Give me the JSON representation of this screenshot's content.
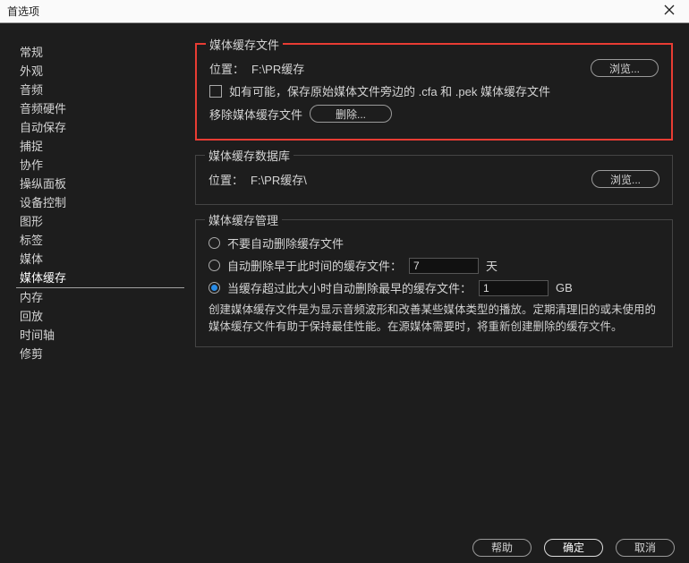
{
  "titlebar": {
    "title": "首选项"
  },
  "sidebar": {
    "items": [
      "常规",
      "外观",
      "音频",
      "音频硬件",
      "自动保存",
      "捕捉",
      "协作",
      "操纵面板",
      "设备控制",
      "图形",
      "标签",
      "媒体",
      "媒体缓存",
      "内存",
      "回放",
      "时间轴",
      "修剪"
    ],
    "selected_index": 12
  },
  "cache_files": {
    "title": "媒体缓存文件",
    "location_label": "位置：",
    "location_value": "F:\\PR缓存",
    "browse": "浏览...",
    "checkbox_label": "如有可能，保存原始媒体文件旁边的 .cfa 和 .pek 媒体缓存文件",
    "remove_label": "移除媒体缓存文件",
    "delete": "删除..."
  },
  "cache_db": {
    "title": "媒体缓存数据库",
    "location_label": "位置：",
    "location_value": "F:\\PR缓存\\",
    "browse": "浏览..."
  },
  "cache_mgmt": {
    "title": "媒体缓存管理",
    "option1": "不要自动删除缓存文件",
    "option2_pre": "自动删除早于此时间的缓存文件：",
    "option2_value": "7",
    "option2_unit": "天",
    "option3_pre": "当缓存超过此大小时自动删除最早的缓存文件：",
    "option3_value": "1",
    "option3_unit": "GB",
    "selected": 3,
    "description": "创建媒体缓存文件是为显示音频波形和改善某些媒体类型的播放。定期清理旧的或未使用的媒体缓存文件有助于保持最佳性能。在源媒体需要时，将重新创建删除的缓存文件。"
  },
  "footer": {
    "help": "帮助",
    "ok": "确定",
    "cancel": "取消"
  }
}
